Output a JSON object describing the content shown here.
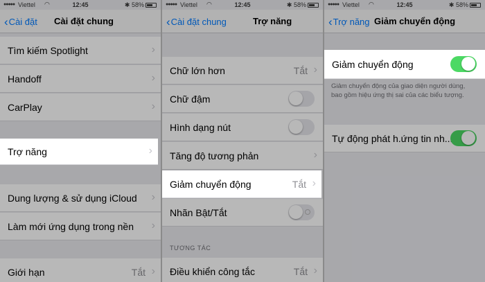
{
  "status": {
    "carrier": "Viettel",
    "time": "12:45",
    "battery": "58%"
  },
  "panel1": {
    "back": "Cài đặt",
    "title": "Cài đặt chung",
    "rows": [
      "Tìm kiếm Spotlight",
      "Handoff",
      "CarPlay",
      "Trợ năng",
      "Dung lượng & sử dụng iCloud",
      "Làm mới ứng dụng trong nền",
      "Giới hạn"
    ],
    "limit_value": "Tắt"
  },
  "panel2": {
    "back": "Cài đặt chung",
    "title": "Trợ năng",
    "rows": [
      "Chữ lớn hơn",
      "Chữ đậm",
      "Hình dạng nút",
      "Tăng độ tương phản",
      "Giảm chuyển động",
      "Nhãn Bật/Tắt",
      "Điều khiển công tắc"
    ],
    "off_value": "Tắt",
    "section_interaction": "TƯƠNG TÁC"
  },
  "panel3": {
    "back": "Trợ năng",
    "title": "Giảm chuyển động",
    "row_reduce_motion": "Giảm chuyển động",
    "description": "Giảm chuyển động của giao diện người dùng, bao gồm hiệu ứng thị sai của các biểu tượng.",
    "row_auto_play": "Tự động phát h.ứng tin nh..."
  },
  "colors": {
    "accent": "#007aff",
    "toggle_on": "#4cd964",
    "background": "#e9e9ee"
  },
  "icons": {
    "back": "chevron-left-icon",
    "disclosure": "chevron-right-icon"
  }
}
